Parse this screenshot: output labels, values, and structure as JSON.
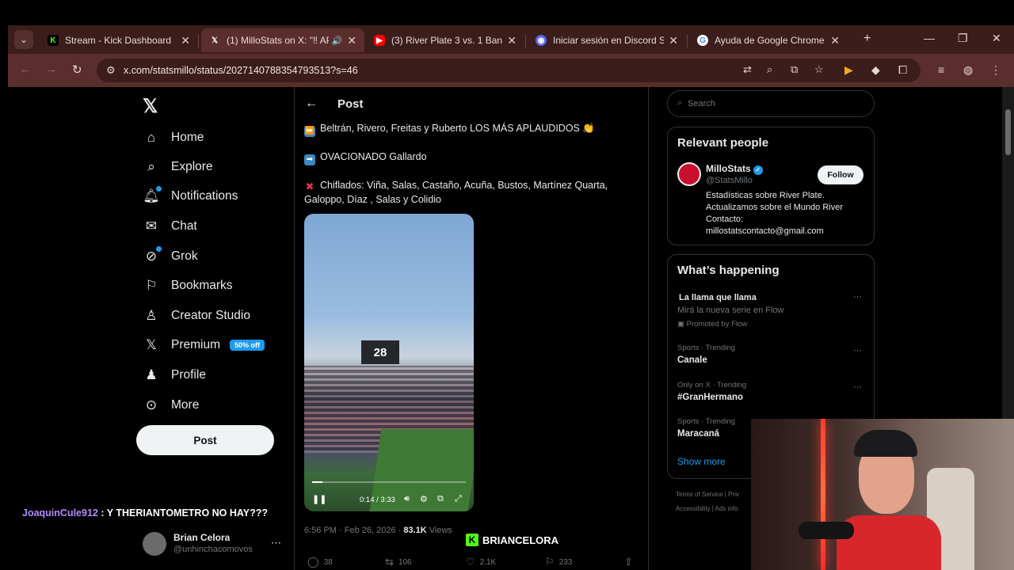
{
  "browser": {
    "tabs": [
      {
        "title": "Stream - Kick Dashboard",
        "favicon": "kick-icon",
        "active": false
      },
      {
        "title": "(1) MilloStats on X: \"‼ AP",
        "favicon": "x-icon",
        "active": true
      },
      {
        "title": "(3) River Plate 3 vs. 1 Banfiel",
        "favicon": "youtube-icon",
        "active": false
      },
      {
        "title": "Iniciar sesión en Discord Sup",
        "favicon": "discord-icon",
        "active": false
      },
      {
        "title": "Ayuda de Google Chrome",
        "favicon": "google-icon",
        "active": false
      }
    ],
    "url": "x.com/statsmillo/status/2027140788354793513?s=46",
    "accent": "#5a2e2c"
  },
  "sidebar": {
    "items": [
      {
        "label": "Home",
        "icon": "home-icon"
      },
      {
        "label": "Explore",
        "icon": "search-icon"
      },
      {
        "label": "Notifications",
        "icon": "bell-icon"
      },
      {
        "label": "Chat",
        "icon": "mail-icon"
      },
      {
        "label": "Grok",
        "icon": "grok-icon"
      },
      {
        "label": "Bookmarks",
        "icon": "bookmark-icon"
      },
      {
        "label": "Creator Studio",
        "icon": "creator-icon"
      },
      {
        "label": "Premium",
        "icon": "x-icon"
      },
      {
        "label": "Profile",
        "icon": "person-icon"
      },
      {
        "label": "More",
        "icon": "more-icon"
      }
    ],
    "premium_badge": "50% off",
    "post_label": "Post",
    "account": {
      "name": "Brian Celora",
      "handle": "@unhinchacomovos"
    }
  },
  "post": {
    "header": "Post",
    "lines": [
      "Beltrán, Rivero, Freitas y Ruberto LOS MÁS APLAUDIDOS",
      "OVACIONADO Gallardo",
      "Chiflados: Viña, Salas, Castaño, Acuña, Bustos, Martínez Quarta,",
      "Galoppo, Díaz , Salas y Colidio"
    ],
    "video": {
      "scoreboard": "28",
      "time": "0:14 / 3:33",
      "progress": 0.066
    },
    "time": "6:56 PM · Feb 26, 2026 ·",
    "views": "83.1K",
    "views_label": "Views",
    "actions": {
      "replies": "38",
      "reposts": "106",
      "likes": "2.1K",
      "bookmarks": "233"
    }
  },
  "right": {
    "search_placeholder": "Search",
    "relevant_title": "Relevant people",
    "person": {
      "name": "MilloStats",
      "handle": "@StatsMillo",
      "follow": "Follow",
      "bio": [
        "Estadísticas sobre River Plate.",
        "Actualizamos sobre el Mundo River",
        "Contacto:",
        "millostatscontacto@gmail.com"
      ]
    },
    "happening_title": "What’s happening",
    "trends": [
      {
        "name": "La llama que llama",
        "sub": "Mirá la nueva serie en Flow",
        "promo": "Promoted by Flow"
      },
      {
        "context": "Sports · Trending",
        "name": "Canale"
      },
      {
        "context": "Only on X · Trending",
        "name": "#GranHermano"
      },
      {
        "context": "Sports · Trending",
        "name": "Maracaná"
      }
    ],
    "show_more": "Show more",
    "footer": [
      "Terms of Service  |  Priv",
      "Accessibility  |  Ads info"
    ]
  },
  "stream": {
    "chat_user": "JoaquinCule912",
    "chat_msg": ": Y THERIANTOMETRO NO HAY???",
    "brand": "BRIANCELORA"
  }
}
